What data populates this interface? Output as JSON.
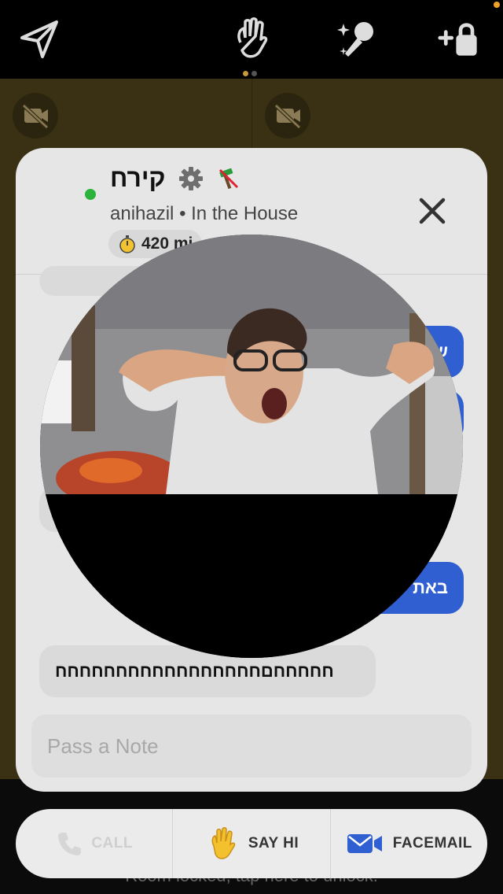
{
  "header": {
    "icons": [
      "send-icon",
      "wave-icon",
      "magic-mic-icon",
      "add-lock-icon"
    ],
    "page_dots": 2,
    "active_dot": 0
  },
  "stage": {
    "tiles": [
      {
        "icon": "camera-off-icon"
      },
      {
        "icon": "camera-off-icon"
      }
    ]
  },
  "profile": {
    "name": "קירח",
    "username": "anihazil",
    "separator": "•",
    "status": "In the House",
    "timer_label": "420 mi",
    "online_color": "#2bb33c"
  },
  "chat": {
    "messages": [
      {
        "direction": "in",
        "text": ""
      },
      {
        "direction": "out",
        "text": "ש"
      },
      {
        "direction": "out",
        "text": ""
      },
      {
        "direction": "in",
        "text": ""
      },
      {
        "direction": "out",
        "text": "באת"
      },
      {
        "direction": "in",
        "text": "חחחחחםחחחחחחחחחחחחחחחחח"
      }
    ],
    "note_placeholder": "Pass a Note"
  },
  "actions": {
    "call_label": "CALL",
    "say_hi_label": "SAY HI",
    "facemail_label": "FACEMAIL"
  },
  "footer": {
    "locked_text": "Room locked, tap here to unlock."
  },
  "colors": {
    "accent_blue": "#2f5fd1",
    "stage_bg": "#3a3114",
    "orange_indicator": "#f0a32a"
  }
}
